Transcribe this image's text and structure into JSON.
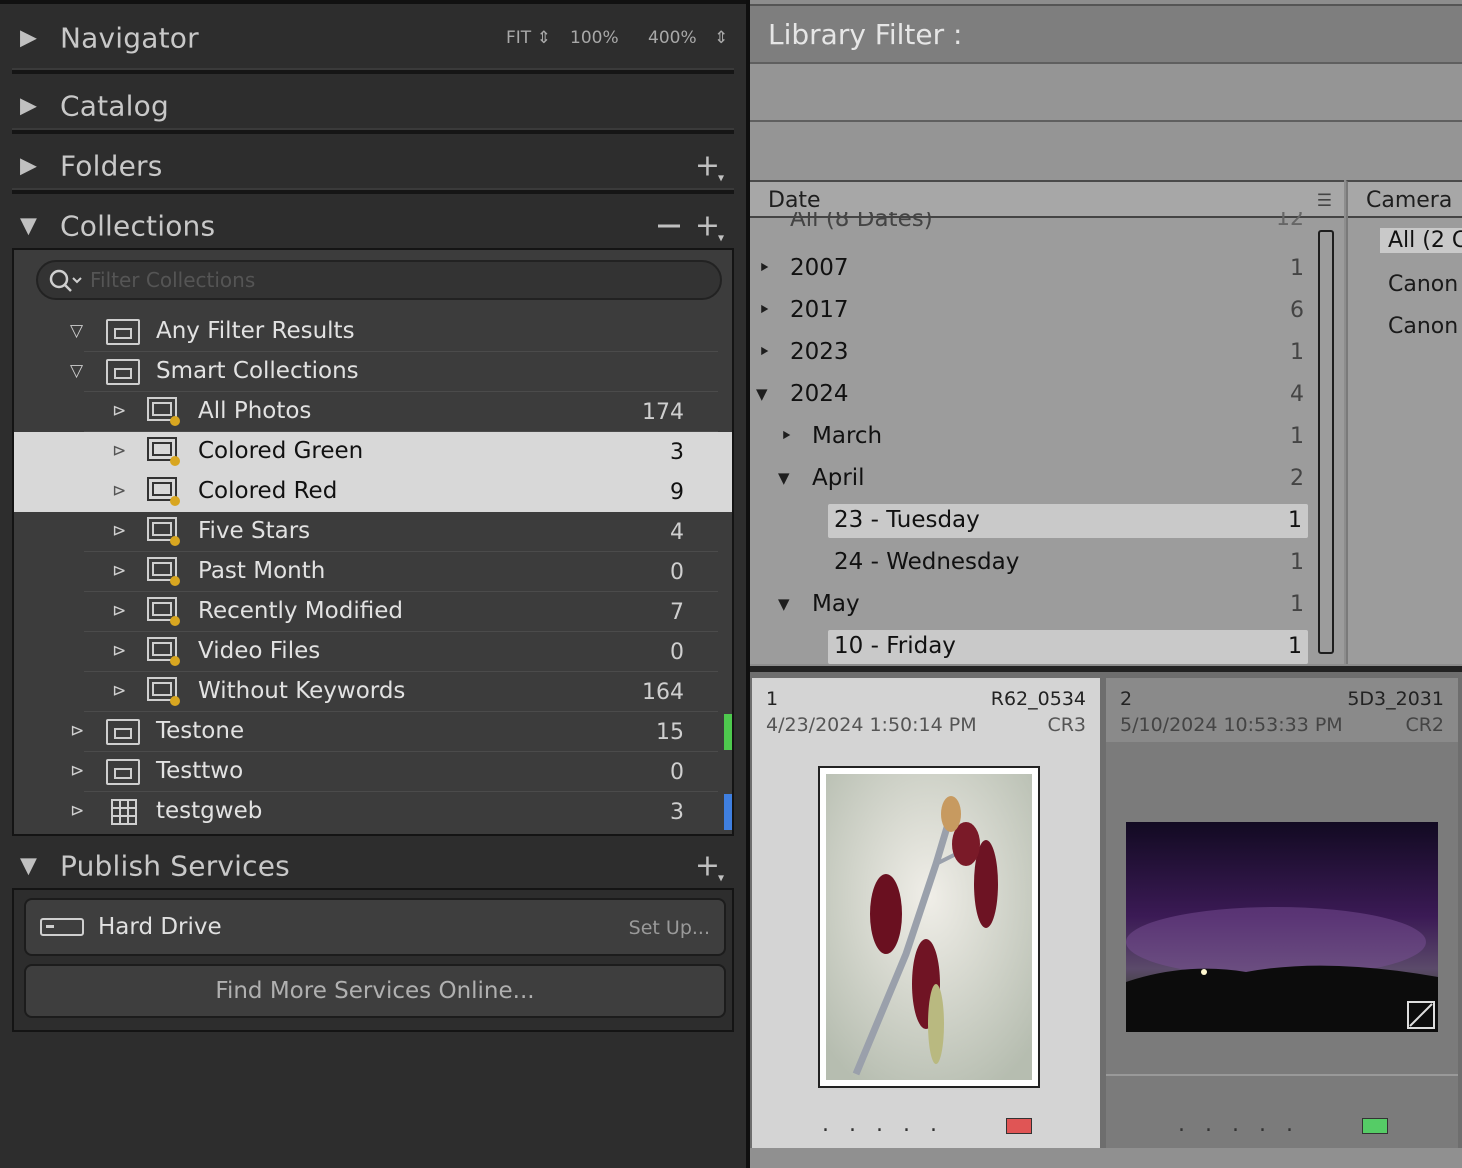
{
  "left_panel": {
    "navigator": {
      "title": "Navigator",
      "fit": "FIT",
      "z100": "100%",
      "z400": "400%"
    },
    "catalog": {
      "title": "Catalog"
    },
    "folders": {
      "title": "Folders"
    },
    "collections": {
      "title": "Collections",
      "filter_placeholder": "Filter Collections",
      "items": [
        {
          "label": "Any Filter Results",
          "count": ""
        },
        {
          "label": "Smart Collections",
          "count": ""
        },
        {
          "label": "All Photos",
          "count": "174"
        },
        {
          "label": "Colored Green",
          "count": "3"
        },
        {
          "label": "Colored Red",
          "count": "9"
        },
        {
          "label": "Five Stars",
          "count": "4"
        },
        {
          "label": "Past Month",
          "count": "0"
        },
        {
          "label": "Recently Modified",
          "count": "7"
        },
        {
          "label": "Video Files",
          "count": "0"
        },
        {
          "label": "Without Keywords",
          "count": "164"
        },
        {
          "label": "Testone",
          "count": "15"
        },
        {
          "label": "Testtwo",
          "count": "0"
        },
        {
          "label": "testgweb",
          "count": "3"
        }
      ]
    },
    "publish": {
      "title": "Publish Services",
      "hard_drive": "Hard Drive",
      "setup": "Set Up...",
      "find_more": "Find More Services Online..."
    }
  },
  "right_panel": {
    "library_filter": "Library Filter :",
    "date_column": {
      "title": "Date",
      "rows": [
        {
          "label": "All (8 Dates)",
          "count": "12"
        },
        {
          "label": "2007",
          "count": "1"
        },
        {
          "label": "2017",
          "count": "6"
        },
        {
          "label": "2023",
          "count": "1"
        },
        {
          "label": "2024",
          "count": "4"
        },
        {
          "label": "March",
          "count": "1"
        },
        {
          "label": "April",
          "count": "2"
        },
        {
          "label": "23 - Tuesday",
          "count": "1"
        },
        {
          "label": "24 - Wednesday",
          "count": "1"
        },
        {
          "label": "May",
          "count": "1"
        },
        {
          "label": "10 - Friday",
          "count": "1"
        }
      ]
    },
    "camera_column": {
      "title": "Camera",
      "items": [
        "All (2 C",
        "Canon",
        "Canon"
      ]
    },
    "grid": [
      {
        "index": "1",
        "filename": "R62_0534",
        "datetime": "4/23/2024 1:50:14 PM",
        "ext": "CR3",
        "color_label": "#e05555",
        "dots": "....."
      },
      {
        "index": "2",
        "filename": "5D3_2031",
        "datetime": "5/10/2024 10:53:33 PM",
        "ext": "CR2",
        "color_label": "#55cc66",
        "dots": "....."
      }
    ]
  },
  "colors": {
    "testone_mark": "#4ec94e",
    "testgweb_mark": "#3f7fe0",
    "selection": "#d8d8d8"
  }
}
